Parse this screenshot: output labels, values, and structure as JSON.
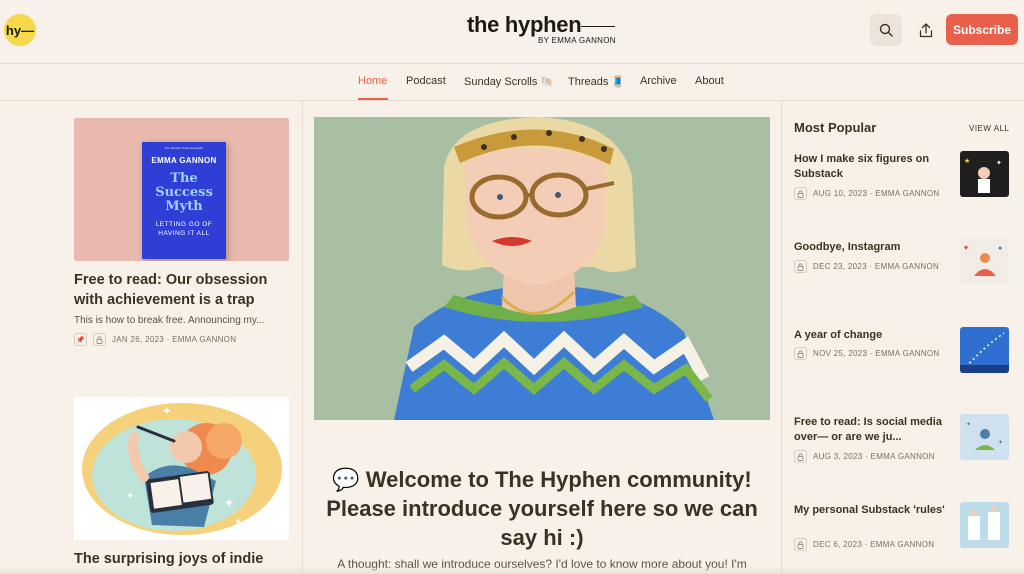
{
  "header": {
    "logo_text": "hy—",
    "title": "the hyphen",
    "byline": "BY EMMA GANNON",
    "subscribe_label": "Subscribe",
    "icons": {
      "search": "search-icon",
      "share": "share-icon"
    }
  },
  "nav": {
    "items": [
      {
        "label": "Home"
      },
      {
        "label": "Podcast"
      },
      {
        "label": "Sunday Scrolls 🐚"
      },
      {
        "label": "Threads 🧵"
      },
      {
        "label": "Archive"
      },
      {
        "label": "About"
      }
    ],
    "active": "Home"
  },
  "left_posts": [
    {
      "book_kicker": "The Sunday Times bestseller",
      "book_author": "EMMA GANNON",
      "book_title_1": "The",
      "book_title_2": "Success",
      "book_title_3": "Myth",
      "book_sub": "LETTING GO OF HAVING IT ALL",
      "title": "Free to read: Our obsession with achievement is a trap",
      "subtitle": "This is how to break free. Announcing my...",
      "meta": "JAN 26, 2023 · EMMA GANNON"
    },
    {
      "title": "The surprising joys of indie"
    }
  ],
  "featured": {
    "title": "💬 Welcome to The Hyphen community! Please introduce yourself here so we can say hi :)",
    "body": "A thought: shall we introduce ourselves? I'd love to know more about you! I'm"
  },
  "popular": {
    "heading": "Most Popular",
    "view_all": "VIEW ALL",
    "items": [
      {
        "title": "How I make six figures on Substack",
        "meta": "AUG 10, 2023 · EMMA GANNON"
      },
      {
        "title": "Goodbye, Instagram",
        "meta": "DEC 23, 2023 · EMMA GANNON"
      },
      {
        "title": "A year of change",
        "meta": "NOV 25, 2023 · EMMA GANNON"
      },
      {
        "title": "Free to read: Is social media over— or are we ju...",
        "meta": "AUG 3, 2023 · EMMA GANNON"
      },
      {
        "title": "My personal Substack 'rules'",
        "meta": "DEC 6, 2023 · EMMA GANNON"
      }
    ]
  },
  "colors": {
    "background": "#f7f1e9",
    "accent": "#e8604c",
    "logo_yellow": "#f6d94a",
    "text": "#3b3224"
  }
}
